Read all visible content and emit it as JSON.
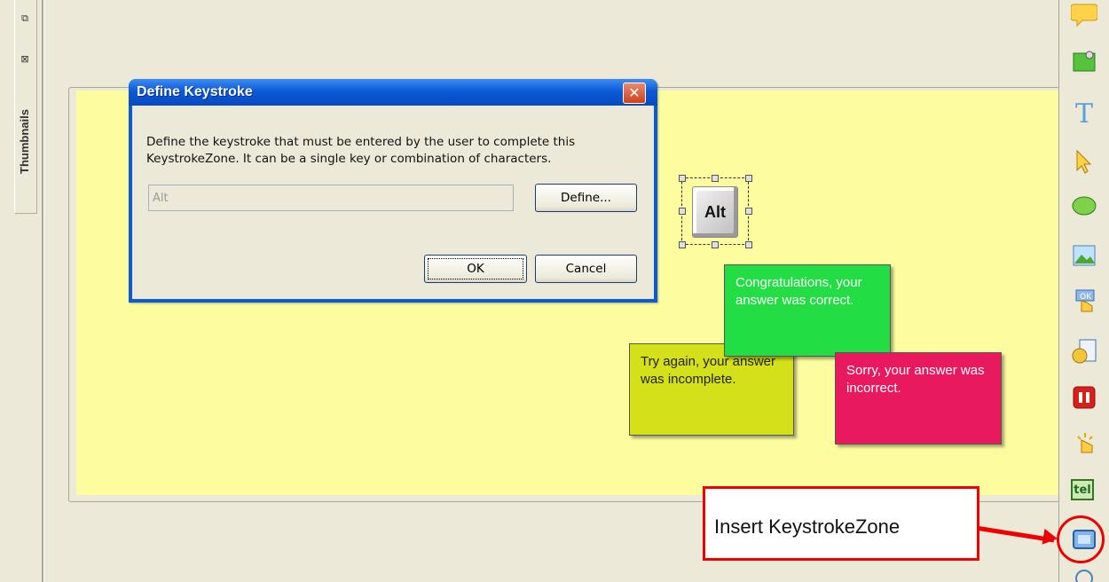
{
  "left_panel": {
    "tab_label": "Thumbnails",
    "restore_glyph": "⧉",
    "close_glyph": "⊠"
  },
  "dialog": {
    "title": "Define Keystroke",
    "close_glyph": "✕",
    "description": "Define the keystroke that must be entered by the user to complete this KeystrokeZone. It can be a single key or combination of characters.",
    "keystroke_value": "Alt",
    "define_label": "Define...",
    "ok_label": "OK",
    "cancel_label": "Cancel"
  },
  "stage": {
    "key_label": "Alt",
    "note_correct": "Congratulations, your answer was correct.",
    "note_incomplete": "Try again, your answer was incomplete.",
    "note_incorrect": "Sorry, your answer was incorrect."
  },
  "toolbar": {
    "icons": [
      "speech-bubble-icon",
      "image-pin-icon",
      "text-tool-icon",
      "pointer-icon",
      "shape-icon",
      "picture-icon",
      "button-icon",
      "media-icon",
      "stop-icon",
      "click-zone-icon",
      "text-entry-icon",
      "keystroke-zone-icon"
    ],
    "text_tool_glyph": "T",
    "text_entry_glyph": "tel"
  },
  "callout": {
    "text": "Insert KeystrokeZone",
    "color": "#ee0000"
  },
  "colors": {
    "stage": "#ffff99",
    "note_correct": "#22dd44",
    "note_incomplete": "#d4e01a",
    "note_incorrect": "#e8195e",
    "titlebar": "#0a5bd6"
  }
}
